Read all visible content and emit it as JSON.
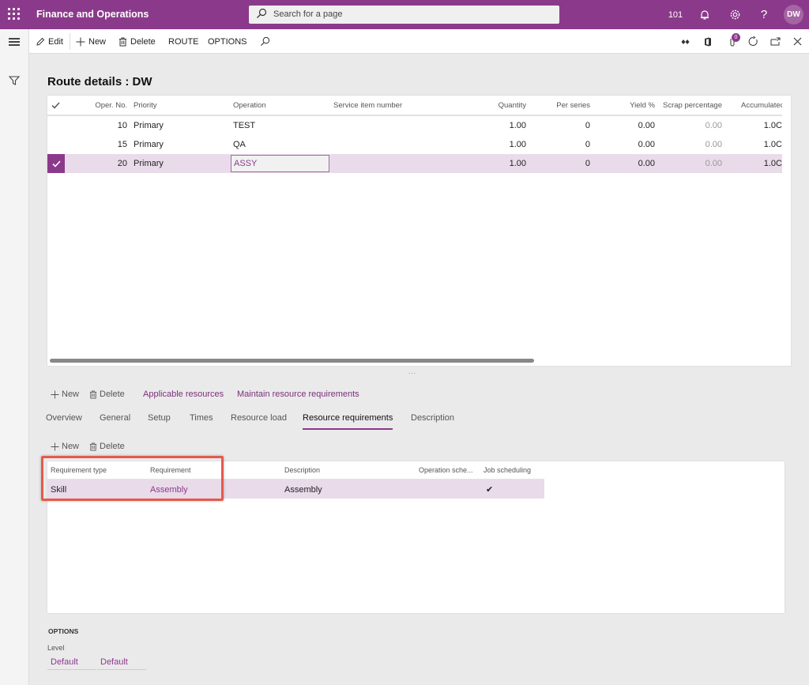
{
  "app": {
    "title": "Finance and Operations",
    "search_placeholder": "Search for a page",
    "company": "101",
    "user_initials": "DW",
    "accent_color": "#8b3a8b"
  },
  "actionbar": {
    "edit": "Edit",
    "new": "New",
    "delete": "Delete",
    "route": "ROUTE",
    "options": "OPTIONS",
    "attachments_count": "0"
  },
  "page": {
    "title": "Route details : DW"
  },
  "route_grid": {
    "columns": [
      "Oper. No.",
      "Priority",
      "Operation",
      "Service item number",
      "Quantity",
      "Per series",
      "Yield %",
      "Scrap percentage",
      "Accumulatec"
    ],
    "rows": [
      {
        "oper_no": "10",
        "priority": "Primary",
        "operation": "TEST",
        "service_item": "",
        "quantity": "1.00",
        "per_series": "0",
        "yield": "0.00",
        "scrap": "0.00",
        "accumulated": "1.0C",
        "selected": false
      },
      {
        "oper_no": "15",
        "priority": "Primary",
        "operation": "QA",
        "service_item": "",
        "quantity": "1.00",
        "per_series": "0",
        "yield": "0.00",
        "scrap": "0.00",
        "accumulated": "1.0C",
        "selected": false
      },
      {
        "oper_no": "20",
        "priority": "Primary",
        "operation": "ASSY",
        "service_item": "",
        "quantity": "1.00",
        "per_series": "0",
        "yield": "0.00",
        "scrap": "0.00",
        "accumulated": "1.0C",
        "selected": true
      }
    ],
    "splitter": "..."
  },
  "lines_actions": {
    "new": "New",
    "delete": "Delete",
    "applicable_resources": "Applicable resources",
    "maintain_resource_requirements": "Maintain resource requirements"
  },
  "tabs": [
    {
      "label": "Overview",
      "active": false
    },
    {
      "label": "General",
      "active": false
    },
    {
      "label": "Setup",
      "active": false
    },
    {
      "label": "Times",
      "active": false
    },
    {
      "label": "Resource load",
      "active": false
    },
    {
      "label": "Resource requirements",
      "active": true
    },
    {
      "label": "Description",
      "active": false
    }
  ],
  "req_actions": {
    "new": "New",
    "delete": "Delete"
  },
  "req_grid": {
    "columns": [
      "Requirement type",
      "Requirement",
      "Description",
      "Operation sche...",
      "Job scheduling"
    ],
    "rows": [
      {
        "requirement_type": "Skill",
        "requirement": "Assembly",
        "description": "Assembly",
        "operation_scheduling": "",
        "job_scheduling": "✔"
      }
    ]
  },
  "options": {
    "title": "OPTIONS",
    "level_label": "Level",
    "level_values": [
      "Default",
      "Default"
    ]
  }
}
